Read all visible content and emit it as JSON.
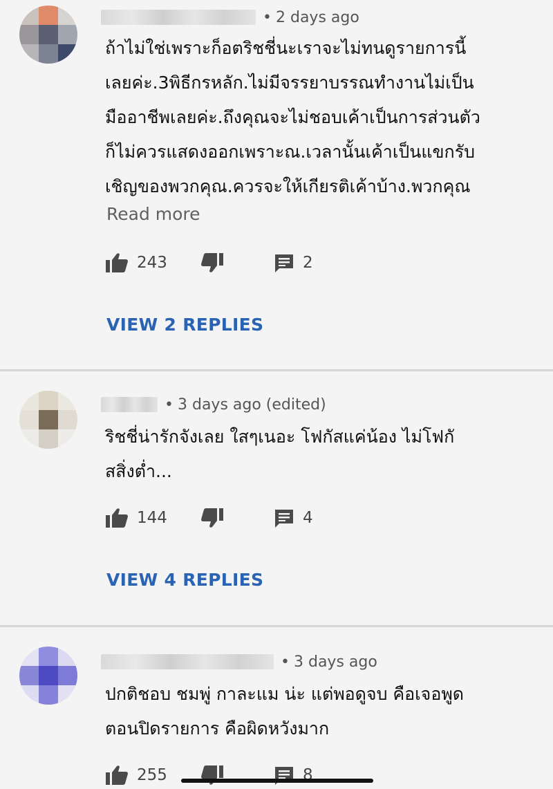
{
  "comments": [
    {
      "meta": "2 days ago",
      "lines": [
        "ถ้าไม่ใช่เพราะก็อตริชชี่นะเราจะไม่ทนดูรายการนี้",
        "เลยค่ะ.3พิธีกรหลัก.ไม่มีจรรยาบรรณทำงานไม่เป็น",
        "มืออาชีพเลยค่ะ.ถึงคุณจะไม่ชอบเค้าเป็นการส่วนตัว",
        "ก็ไม่ควรแสดงออกเพราะณ.เวลานั้นเค้าเป็นแขกรับ",
        "เชิญของพวกคุณ.ควรจะให้เกียรติเค้าบ้าง.พวกคุณ"
      ],
      "read_more": "Read more",
      "likes": "243",
      "replies_count": "2",
      "view_replies": "VIEW 2 REPLIES"
    },
    {
      "meta": "3 days ago (edited)",
      "lines": [
        "ริชชี่น่ารักจังเลย ใสๆเนอะ โฟกัสแค่น้อง ไม่โฟกั",
        "สสิ่งต่ำ..."
      ],
      "likes": "144",
      "replies_count": "4",
      "view_replies": "VIEW 4 REPLIES"
    },
    {
      "meta": "3 days ago",
      "lines": [
        "ปกติชอบ ชมพู่ กาละแม น่ะ แต่พอดูจบ คือเจอพูด",
        "ตอนปิดรายการ คือผิดหวังมาก"
      ],
      "likes": "255",
      "replies_count": "8"
    }
  ],
  "icons": {
    "like": "thumbs-up-icon",
    "dislike": "thumbs-down-icon",
    "reply": "comment-reply-icon"
  },
  "colors": {
    "link": "#2a62b4",
    "text": "#111111",
    "secondary": "#606060",
    "background": "#f4f4f4"
  }
}
